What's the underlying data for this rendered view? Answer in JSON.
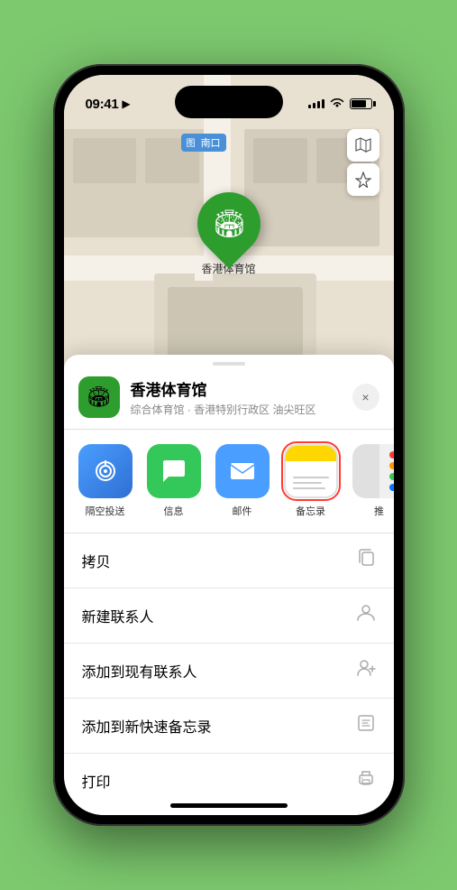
{
  "status_bar": {
    "time": "09:41",
    "time_icon": "location-arrow-icon"
  },
  "map": {
    "label_text": "南口",
    "pin_label": "香港体育馆",
    "pin_emoji": "🏟"
  },
  "map_controls": {
    "map_btn_icon": "🗺",
    "location_btn_icon": "➤"
  },
  "venue": {
    "name": "香港体育馆",
    "subtitle": "综合体育馆 · 香港特别行政区 油尖旺区",
    "icon_emoji": "🏟"
  },
  "apps": [
    {
      "id": "airdrop",
      "label": "隔空投送",
      "selected": false
    },
    {
      "id": "messages",
      "label": "信息",
      "selected": false
    },
    {
      "id": "mail",
      "label": "邮件",
      "selected": false
    },
    {
      "id": "notes",
      "label": "备忘录",
      "selected": true
    },
    {
      "id": "more",
      "label": "推",
      "selected": false
    }
  ],
  "actions": [
    {
      "label": "拷贝",
      "icon": "copy"
    },
    {
      "label": "新建联系人",
      "icon": "person"
    },
    {
      "label": "添加到现有联系人",
      "icon": "person-add"
    },
    {
      "label": "添加到新快速备忘录",
      "icon": "note"
    },
    {
      "label": "打印",
      "icon": "print"
    }
  ],
  "close_btn": "×"
}
